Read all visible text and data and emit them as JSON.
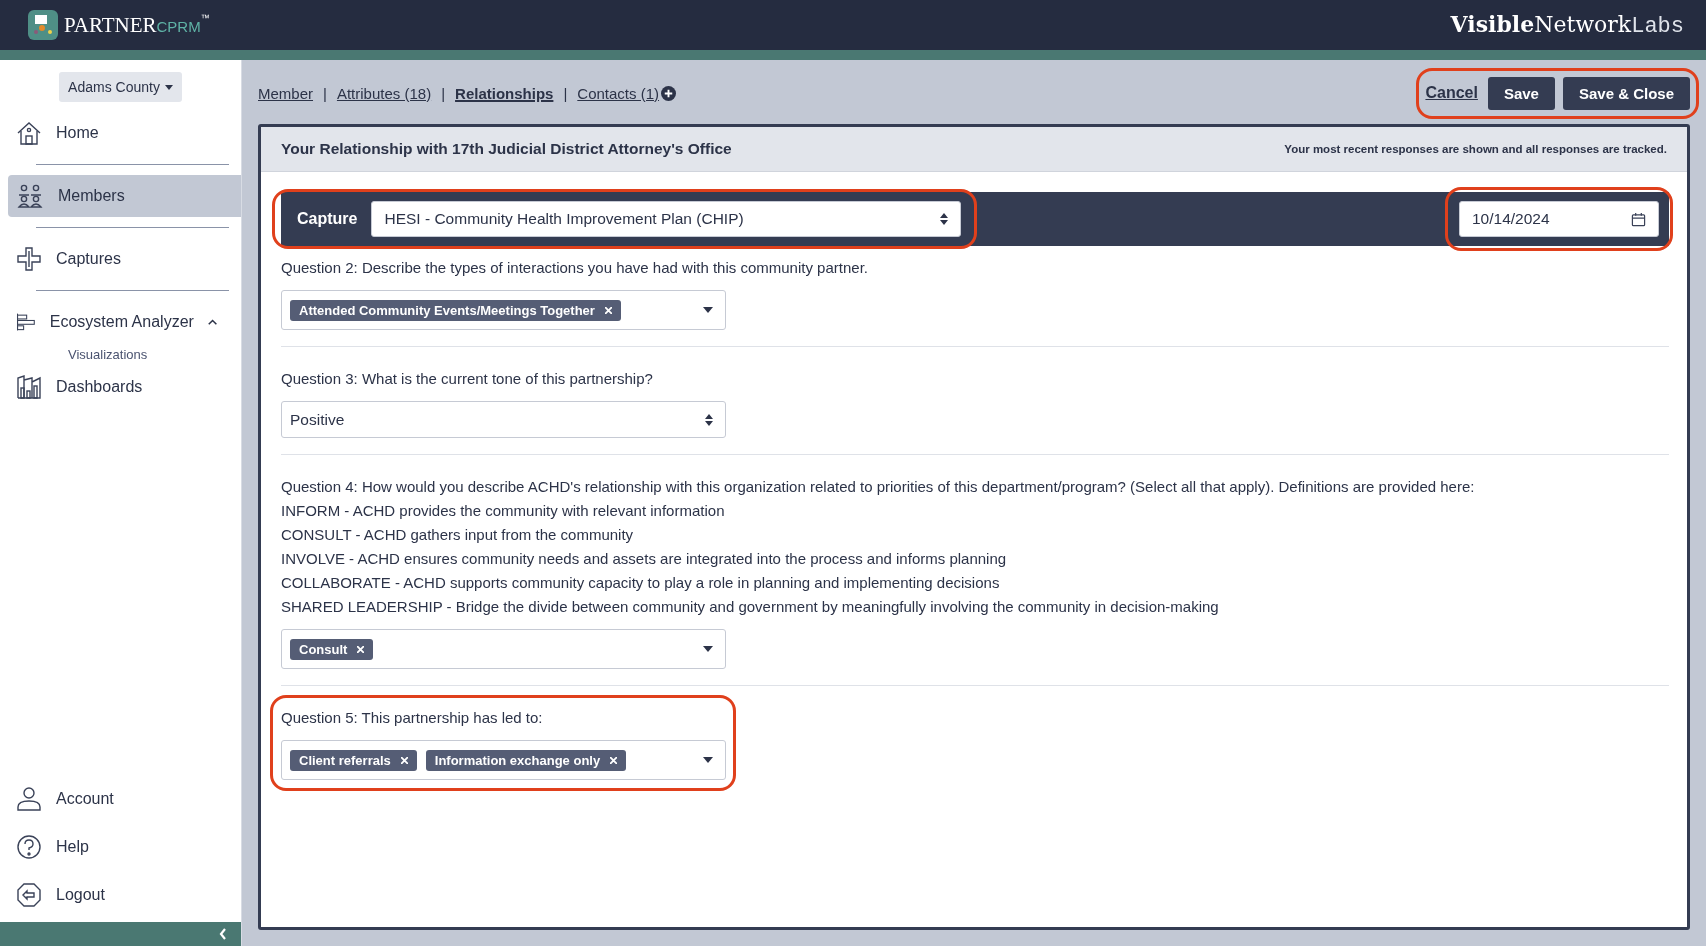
{
  "header": {
    "logo": {
      "name": "PARTNER",
      "suffix": "CPRM",
      "mark": "™"
    },
    "brand": [
      "Visible",
      "Network",
      "Labs"
    ]
  },
  "sidebar": {
    "org_selector": "Adams County",
    "items": [
      {
        "kind": "home",
        "label": "Home",
        "selected": false
      },
      {
        "kind": "members",
        "label": "Members",
        "selected": true
      },
      {
        "kind": "captures",
        "label": "Captures",
        "selected": false
      },
      {
        "kind": "analyzer",
        "label": "Ecosystem Analyzer",
        "selected": false,
        "expanded": true,
        "children": [
          {
            "label": "Visualizations",
            "selected": false
          }
        ]
      },
      {
        "kind": "dashboards",
        "label": "Dashboards",
        "selected": false
      }
    ],
    "bottom_items": [
      {
        "kind": "account",
        "label": "Account"
      },
      {
        "kind": "help",
        "label": "Help"
      },
      {
        "kind": "logout",
        "label": "Logout"
      }
    ]
  },
  "tab_separators": [
    "|",
    "|",
    "|"
  ],
  "tabs": [
    {
      "label": "Member",
      "selected": false
    },
    {
      "label": "Attributes (18)",
      "selected": false
    },
    {
      "label": "Relationships",
      "selected": true
    },
    {
      "label": "Contacts (1)",
      "selected": false,
      "has_add": true
    }
  ],
  "actions": {
    "cancel": "Cancel",
    "buttons": [
      "Save",
      "Save & Close"
    ],
    "highlighted": true
  },
  "panel": {
    "title": "Your Relationship with 17th Judicial District Attorney's Office",
    "note": "Your most recent responses are shown and all responses are tracked."
  },
  "capture": {
    "label": "Capture",
    "value": "HESI - Community Health Improvement Plan (CHIP)",
    "highlighted": true
  },
  "date": {
    "value": "10/14/2024",
    "highlighted": true
  },
  "questions": [
    {
      "kind": "multi",
      "prompt": "Question 2: Describe the types of interactions you have had with this community partner.",
      "tags": [
        "Attended Community Events/Meetings Together"
      ],
      "highlighted": false
    },
    {
      "kind": "select",
      "prompt": "Question 3: What is the current tone of this partnership?",
      "value": "Positive",
      "highlighted": false
    },
    {
      "kind": "multi",
      "prompt": "Question 4: How would you describe ACHD's relationship with this organization related to priorities of this department/program? (Select all that apply). Definitions are provided here:",
      "definitions": [
        "INFORM - ACHD provides the community with relevant information",
        "CONSULT - ACHD gathers input from the community",
        "INVOLVE - ACHD ensures community needs and assets are integrated into the process and informs planning",
        "COLLABORATE - ACHD supports community capacity to play a role in planning and implementing decisions",
        "SHARED LEADERSHIP - Bridge the divide between community and government by meaningfully involving the community in decision-making"
      ],
      "tags": [
        "Consult"
      ],
      "highlighted": false
    },
    {
      "kind": "multi",
      "prompt": "Question 5: This partnership has led to:",
      "tags": [
        "Client referrals",
        "Information exchange only"
      ],
      "highlighted": true
    }
  ]
}
